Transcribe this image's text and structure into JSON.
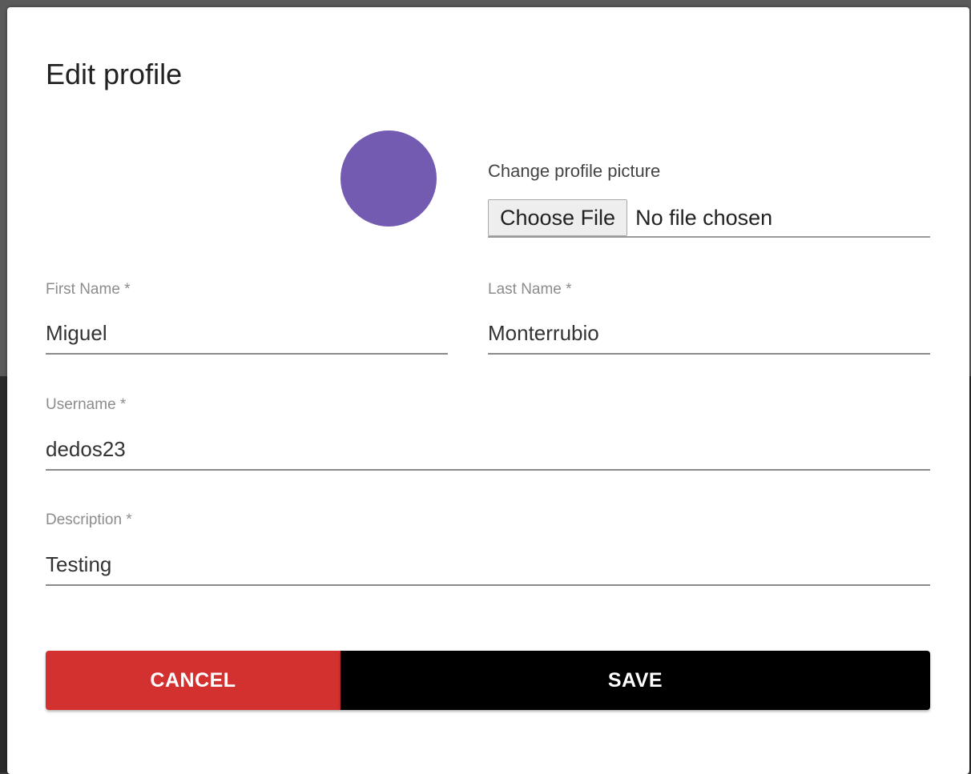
{
  "dialog": {
    "title": "Edit profile"
  },
  "profile_picture": {
    "label": "Change profile picture",
    "button_label": "Choose File",
    "status": "No file chosen",
    "avatar_color": "#735bb1"
  },
  "fields": {
    "first_name": {
      "label": "First Name *",
      "value": "Miguel"
    },
    "last_name": {
      "label": "Last Name *",
      "value": "Monterrubio"
    },
    "username": {
      "label": "Username *",
      "value": "dedos23"
    },
    "description": {
      "label": "Description *",
      "value": "Testing"
    }
  },
  "actions": {
    "cancel_label": "CANCEL",
    "save_label": "SAVE",
    "cancel_color": "#d33030",
    "save_color": "#000000"
  }
}
